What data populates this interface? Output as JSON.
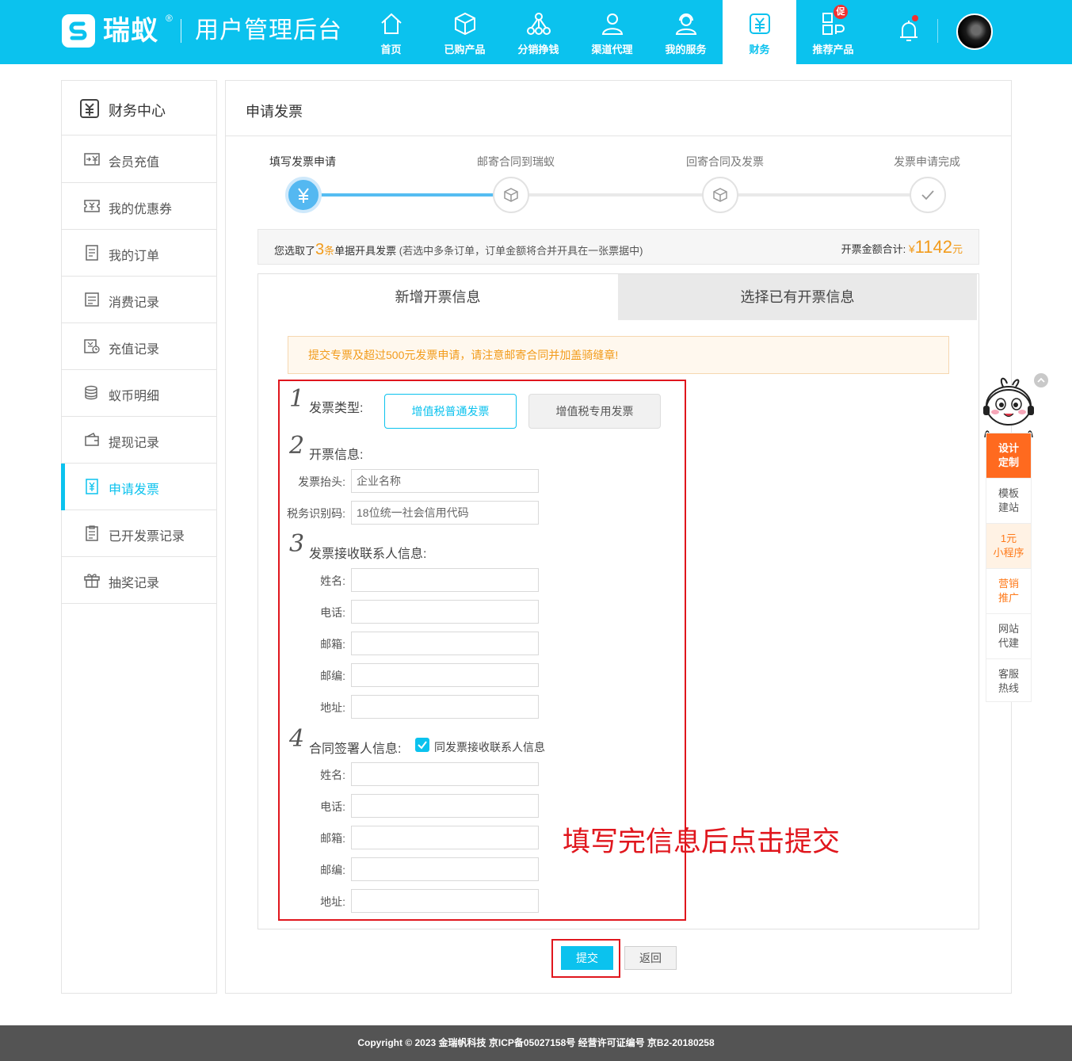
{
  "header": {
    "brand": "瑞蚁",
    "reg_mark": "®",
    "subtitle": "用户管理后台",
    "nav": [
      {
        "label": "首页",
        "icon": "home-icon"
      },
      {
        "label": "已购产品",
        "icon": "box-icon"
      },
      {
        "label": "分销挣钱",
        "icon": "network-icon"
      },
      {
        "label": "渠道代理",
        "icon": "agent-icon"
      },
      {
        "label": "我的服务",
        "icon": "headset-icon"
      },
      {
        "label": "财务",
        "icon": "finance-icon"
      },
      {
        "label": "推荐产品",
        "icon": "recommend-icon"
      }
    ],
    "promo_badge": "促",
    "active_color": "#0bc2ee"
  },
  "sidebar": {
    "title": "财务中心",
    "items": [
      {
        "label": "会员充值",
        "icon": "recharge-icon"
      },
      {
        "label": "我的优惠券",
        "icon": "coupon-icon"
      },
      {
        "label": "我的订单",
        "icon": "order-icon"
      },
      {
        "label": "消费记录",
        "icon": "consume-icon"
      },
      {
        "label": "充值记录",
        "icon": "recharge-record-icon"
      },
      {
        "label": "蚁币明细",
        "icon": "coins-icon"
      },
      {
        "label": "提现记录",
        "icon": "wallet-icon"
      },
      {
        "label": "申请发票",
        "icon": "invoice-icon"
      },
      {
        "label": "已开发票记录",
        "icon": "invoice-record-icon"
      },
      {
        "label": "抽奖记录",
        "icon": "gift-icon"
      }
    ],
    "active_index": 7
  },
  "main": {
    "title": "申请发票",
    "steps": [
      "填写发票申请",
      "邮寄合同到瑞蚁",
      "回寄合同及发票",
      "发票申请完成"
    ],
    "current_step": 1,
    "summary": {
      "prefix": "您选取了",
      "count": "3",
      "count_unit": "条",
      "suffix": "单据开具发票",
      "note": "(若选中多条订单，订单金额将合并开具在一张票据中)",
      "total_label": "开票金额合计:",
      "currency": "¥",
      "amount": "1142",
      "amount_unit": "元"
    },
    "tabs": [
      "新增开票信息",
      "选择已有开票信息"
    ],
    "notice": "提交专票及超过500元发票申请，请注意邮寄合同并加盖骑缝章!",
    "sections": {
      "s1": {
        "num": "1",
        "title": "发票类型:"
      },
      "s2": {
        "num": "2",
        "title": "开票信息:"
      },
      "s3": {
        "num": "3",
        "title": "发票接收联系人信息:"
      },
      "s4": {
        "num": "4",
        "title": "合同签署人信息:"
      }
    },
    "invoice_types": [
      "增值税普通发票",
      "增值税专用发票"
    ],
    "invoice_fields": [
      {
        "label": "发票抬头:",
        "placeholder": "企业名称"
      },
      {
        "label": "税务识别码:",
        "placeholder": "18位统一社会信用代码"
      }
    ],
    "receiver_fields": [
      "姓名:",
      "电话:",
      "邮箱:",
      "邮编:",
      "地址:"
    ],
    "same_as_receiver": "同发票接收联系人信息",
    "signer_fields": [
      "姓名:",
      "电话:",
      "邮箱:",
      "邮编:",
      "地址:"
    ],
    "annotation": "填写完信息后点击提交",
    "submit": "提交",
    "back": "返回"
  },
  "float_bar": {
    "items": [
      "设计\n定制",
      "模板\n建站",
      "1元\n小程序",
      "营销\n推广",
      "网站\n代建",
      "客服\n热线"
    ]
  },
  "footer": {
    "text": "Copyright © 2023 金瑞帆科技 京ICP备05027158号 经营许可证编号 京B2-20180258"
  }
}
